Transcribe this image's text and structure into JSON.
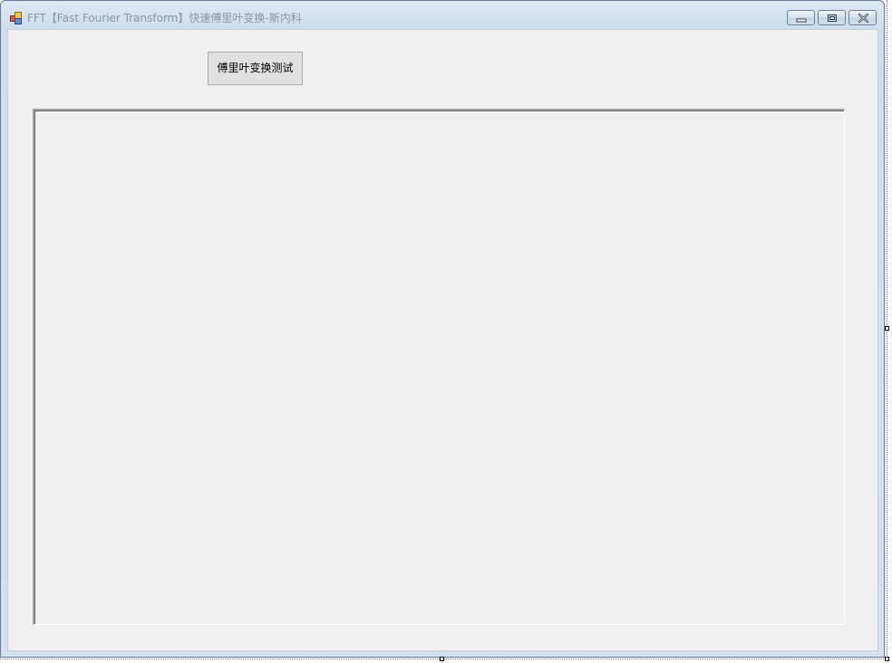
{
  "window": {
    "title": "FFT【Fast Fourier Transform】快速傅里叶变换-斯内科"
  },
  "caption_buttons": {
    "minimize_icon": "minimize-icon",
    "maximize_icon": "restore-icon",
    "close_icon": "close-icon"
  },
  "form": {
    "test_button_label": "傅里叶变换测试"
  },
  "colors": {
    "client_background": "#f0f0f0",
    "button_background": "#e1e1e1",
    "title_text": "#8e949c"
  }
}
